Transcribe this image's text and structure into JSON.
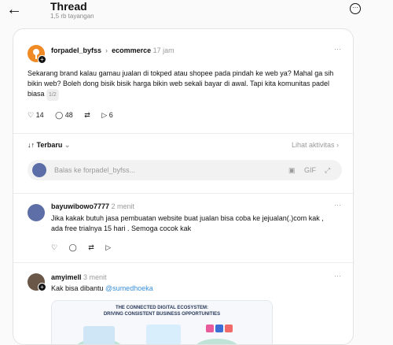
{
  "header": {
    "title": "Thread",
    "views": "1,5 rb tayangan"
  },
  "post": {
    "username": "forpadel_byfss",
    "community": "ecommerce",
    "time": "17 jam",
    "body": "Sekarang brand kalau gamau jualan di tokped atau shopee pada pindah ke web ya? Mahal ga sih bikin web? Boleh dong bisik bisik harga bikin web sekali bayar di awal. Tapi kita komunitas padel biasa",
    "page_indicator": "1/2",
    "likes": "14",
    "replies": "48",
    "shares": "6"
  },
  "sort": {
    "label": "Terbaru",
    "activity_link": "Lihat aktivitas"
  },
  "reply_box": {
    "placeholder": "Balas ke forpadel_byfss..."
  },
  "replies": [
    {
      "username": "bayuwibowo7777",
      "time": "2 menit",
      "body": "Jika kakak butuh jasa pembuatan website buat jualan bisa coba ke jejualan(.)com kak , ada free trialnya 15 hari . Semoga cocok kak"
    },
    {
      "username": "amyimell",
      "time": "3 menit",
      "body_prefix": "Kak bisa dibantu ",
      "mention": "@sumedhoeka",
      "image_title_line1": "THE CONNECTED DIGITAL ECOSYSTEM:",
      "image_title_line2": "DRIVING CONSISTENT BUSINESS OPPORTUNITIES"
    }
  ]
}
